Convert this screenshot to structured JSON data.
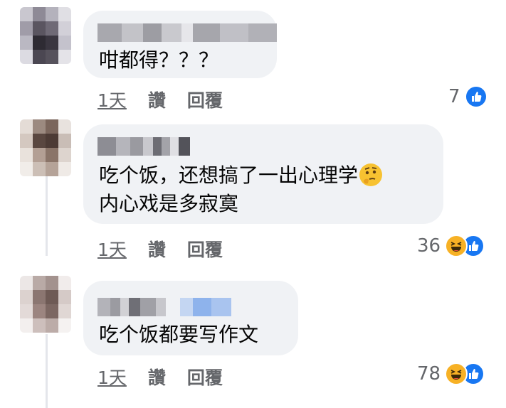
{
  "colors": {
    "bubble_bg": "#f0f2f5",
    "secondary_text": "#65676b",
    "like_blue": "#1877f2",
    "haha_yellow": "#f7b125"
  },
  "comments": [
    {
      "text_lines": [
        "咁都得？？？"
      ],
      "time": "1天",
      "like_label": "讚",
      "reply_label": "回覆",
      "reaction_count": "7",
      "reaction_icons": [
        "like-icon"
      ]
    },
    {
      "text_lines": [
        "吃个饭，还想搞了一出心理学",
        "内心戏是多寂寞"
      ],
      "inline_emoji": "thinking-face-emoji",
      "time": "1天",
      "like_label": "讚",
      "reply_label": "回覆",
      "reaction_count": "36",
      "reaction_icons": [
        "haha-icon",
        "like-icon"
      ]
    },
    {
      "text_lines": [
        "吃个饭都要写作文"
      ],
      "time": "1天",
      "like_label": "讚",
      "reply_label": "回覆",
      "reaction_count": "78",
      "reaction_icons": [
        "haha-icon",
        "like-icon"
      ]
    }
  ]
}
